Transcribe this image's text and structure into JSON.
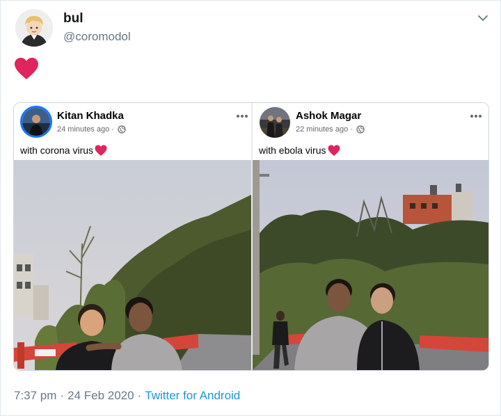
{
  "tweet": {
    "display_name": "bul",
    "handle": "@coromodol",
    "body_emoji": "red-heart",
    "time": "7:37 pm",
    "date": "24 Feb 2020",
    "separator": "·",
    "source": "Twitter for Android"
  },
  "quoted_image": {
    "left_post": {
      "author": "Kitan Khadka",
      "time_ago": "24 minutes ago",
      "separator": "·",
      "caption": "with corona virus",
      "privacy_icon": "globe-icon",
      "menu_icon": "more-icon"
    },
    "right_post": {
      "author": "Ashok Magar",
      "time_ago": "22 minutes ago",
      "separator": "·",
      "caption": "with ebola virus",
      "privacy_icon": "globe-icon",
      "menu_icon": "more-icon"
    }
  },
  "colors": {
    "link": "#1b95e0",
    "muted": "#657786",
    "heart": "#e0245e",
    "facebook_blue": "#1877f2"
  }
}
